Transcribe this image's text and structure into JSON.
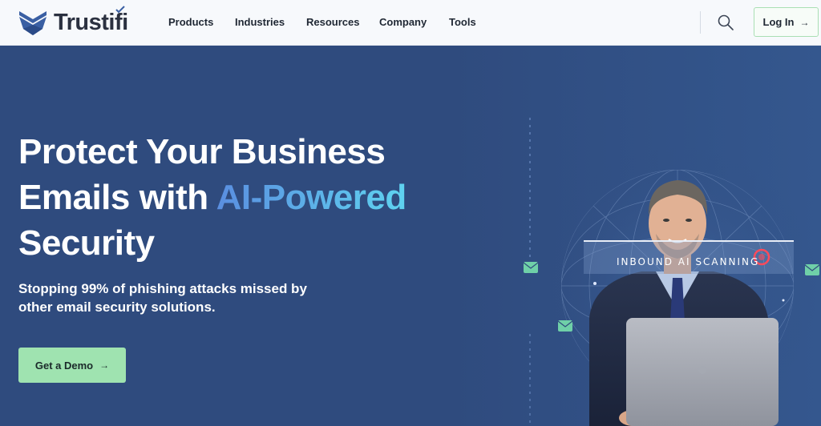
{
  "brand": {
    "name": "Trustifi",
    "logo_icon": "trustifi-shield-logo",
    "accent": "#3a5fa3"
  },
  "nav": {
    "items": [
      "Products",
      "Industries",
      "Resources",
      "Company",
      "Tools"
    ]
  },
  "header": {
    "search_icon": "search-icon",
    "login_label": "Log In",
    "login_arrow": "→"
  },
  "hero": {
    "title_line1": "Protect Your Business",
    "title_line2_part1": "Emails with ",
    "title_line2_highlight": "AI-Powered",
    "title_line3": "Security",
    "subtitle": "Stopping 99% of phishing attacks missed by other email security solutions.",
    "cta_label": "Get a Demo",
    "cta_arrow": "→"
  },
  "illustration": {
    "scan_label": "INBOUND AI SCANNING",
    "icons": [
      "envelope-icon",
      "envelope-icon",
      "envelope-icon",
      "alert-ring-icon"
    ]
  },
  "colors": {
    "cta_green": "#9fe3b0",
    "hero_bg": "#2f4b7e",
    "highlight_start": "#5a8ee0",
    "highlight_end": "#5fd3f0"
  }
}
